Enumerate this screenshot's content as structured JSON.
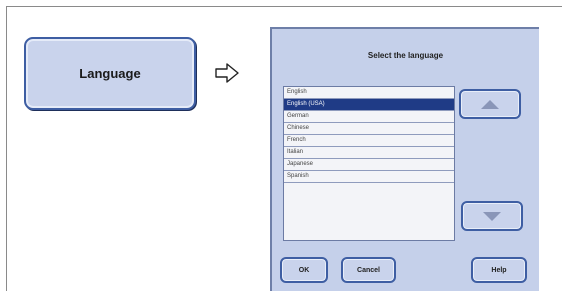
{
  "left_button": {
    "label": "Language"
  },
  "arrow": {
    "icon": "right-arrow-icon"
  },
  "dialog": {
    "title": "Select the language",
    "languages": [
      {
        "label": "English",
        "selected": false
      },
      {
        "label": "English (USA)",
        "selected": true
      },
      {
        "label": "German",
        "selected": false
      },
      {
        "label": "Chinese",
        "selected": false
      },
      {
        "label": "French",
        "selected": false
      },
      {
        "label": "Italian",
        "selected": false
      },
      {
        "label": "Japanese",
        "selected": false
      },
      {
        "label": "Spanish",
        "selected": false
      }
    ],
    "scroll_up_icon": "up-triangle-icon",
    "scroll_down_icon": "down-triangle-icon",
    "ok_label": "OK",
    "cancel_label": "Cancel",
    "help_label": "Help"
  },
  "colors": {
    "button_fill": "#c9d3ec",
    "button_border": "#3e5ea3",
    "dialog_bg": "#c5d0ea",
    "selected_row": "#1f3b86"
  }
}
